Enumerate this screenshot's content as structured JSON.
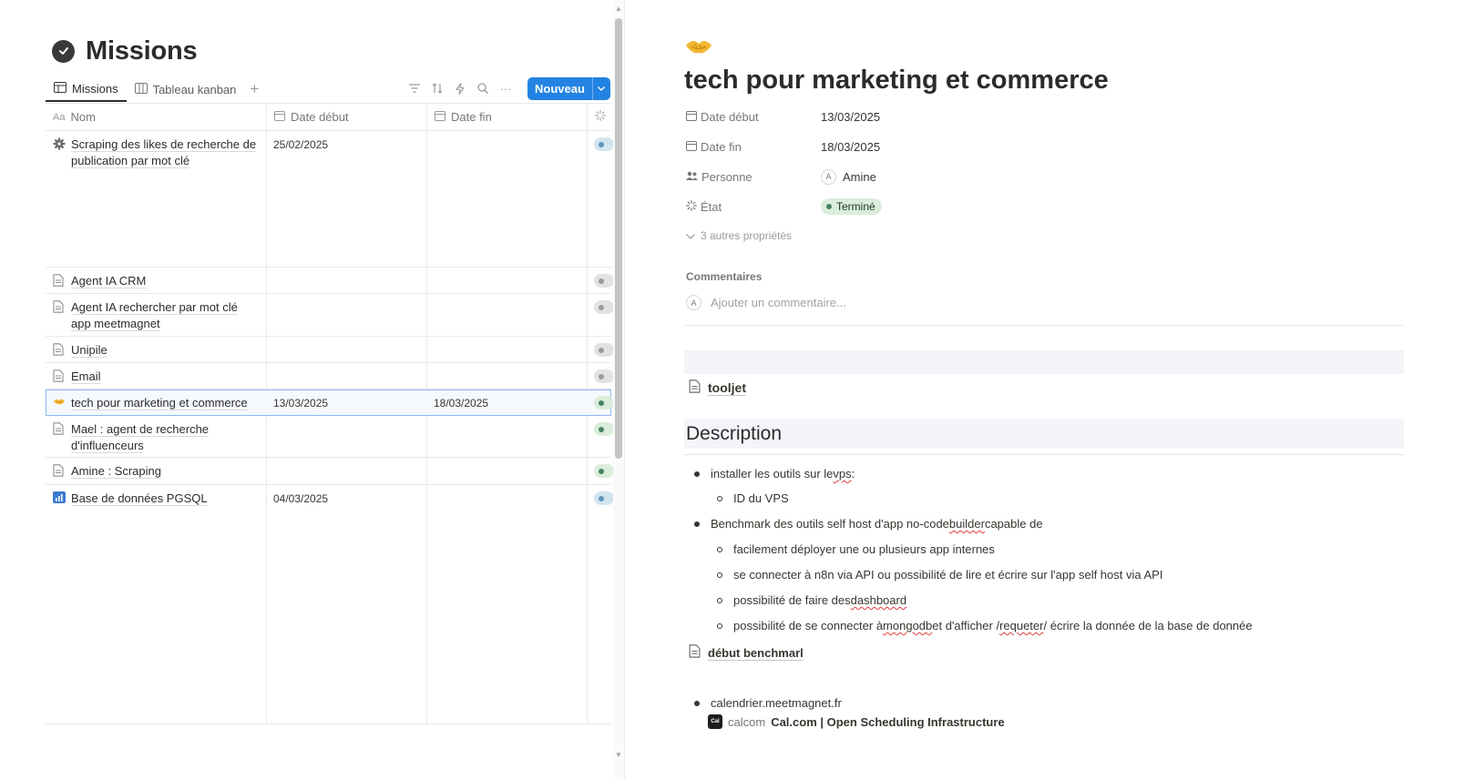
{
  "database": {
    "title": "Missions",
    "tabs": [
      {
        "label": "Missions",
        "active": true,
        "icon": "table-icon"
      },
      {
        "label": "Tableau kanban",
        "active": false,
        "icon": "board-icon"
      }
    ],
    "new_button_label": "Nouveau",
    "columns": [
      "Nom",
      "Date début",
      "Date fin"
    ],
    "rows": [
      {
        "icon": "gear-icon",
        "name": "Scraping des likes de recherche de publication par mot clé",
        "start": "25/02/2025",
        "end": "",
        "status_color": "#5b97bd"
      },
      {
        "icon": "page-icon",
        "name": "Agent IA CRM",
        "start": "",
        "end": "",
        "status_color": "#9b9a97"
      },
      {
        "icon": "page-icon",
        "name": "Agent IA rechercher par mot clé app meetmagnet",
        "start": "",
        "end": "",
        "status_color": "#9b9a97"
      },
      {
        "icon": "page-icon",
        "name": "Unipile",
        "start": "",
        "end": "",
        "status_color": "#9b9a97"
      },
      {
        "icon": "page-icon",
        "name": "Email",
        "start": "",
        "end": "",
        "status_color": "#9b9a97"
      },
      {
        "icon": "handshake-icon",
        "name": "tech pour marketing et commerce",
        "start": "13/03/2025",
        "end": "18/03/2025",
        "status_color": "#448361"
      },
      {
        "icon": "page-icon",
        "name": "Mael : agent de recherche d'influenceurs",
        "start": "",
        "end": "",
        "status_color": "#448361"
      },
      {
        "icon": "page-icon",
        "name": "Amine : Scraping",
        "start": "",
        "end": "",
        "status_color": "#448361"
      },
      {
        "icon": "chart-icon",
        "name": "Base de données PGSQL",
        "start": "04/03/2025",
        "end": "",
        "status_color": "#5b97bd"
      }
    ]
  },
  "page": {
    "title": "tech pour marketing et commerce",
    "properties": {
      "start_label": "Date début",
      "start_value": "13/03/2025",
      "end_label": "Date fin",
      "end_value": "18/03/2025",
      "person_label": "Personne",
      "person_initial": "A",
      "person_value": "Amine",
      "state_label": "État",
      "state_value": "Terminé"
    },
    "more_properties": "3 autres propriétés",
    "comments_title": "Commentaires",
    "comment_initial": "A",
    "comment_placeholder": "Ajouter un commentaire...",
    "link_tooljet": "tooljet",
    "description_heading": "Description",
    "bullets": {
      "b1_pre": "installer les outils sur le ",
      "b1_err": "vps",
      "b1_post": " :",
      "b1a": "ID du VPS",
      "b2_pre": "Benchmark des outils self host d'app no-code ",
      "b2_err": "builder",
      "b2_post": " capable de",
      "b2a": "facilement déployer une ou plusieurs app internes",
      "b2b": "se connecter à n8n via API ou possibilité de lire et écrire sur l'app self host via API",
      "b2c_pre": "possibilité de faire des ",
      "b2c_err": "dashboard",
      "b2d_pre": "possibilité de se connecter à ",
      "b2d_err1": "mongodb",
      "b2d_mid": " et d'afficher / ",
      "b2d_err2": "requeter",
      "b2d_post": " / écrire la donnée de la base de donnée",
      "b3": "calendrier.meetmagnet.fr"
    },
    "link_benchmark": "début benchmarl",
    "bookmark": {
      "logo_text": "Cal",
      "site": "calcom",
      "title": "Cal.com | Open Scheduling Infrastructure"
    }
  },
  "colors": {
    "accent": "#2383e2",
    "done_green": "#448361",
    "progress_blue": "#5b97bd"
  }
}
